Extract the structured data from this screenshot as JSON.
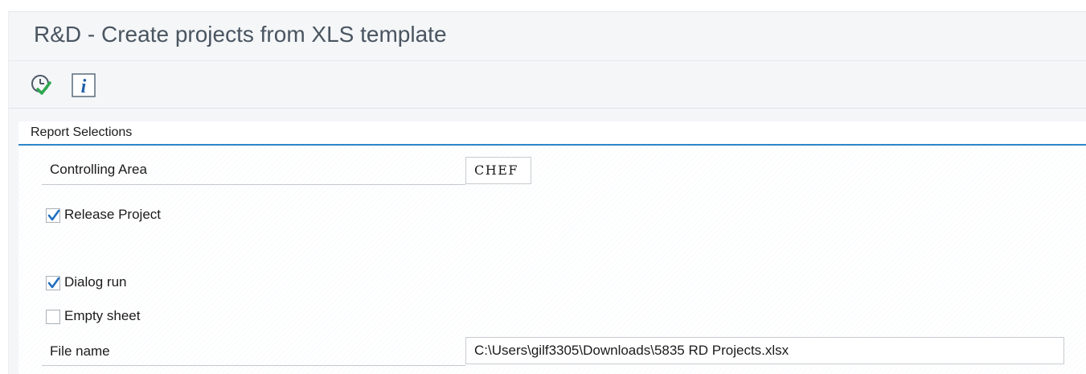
{
  "page": {
    "title": "R&D - Create projects from XLS template"
  },
  "toolbar": {
    "execute_icon": "execute-clock-check-icon",
    "info_icon": "info-icon"
  },
  "section": {
    "title": "Report Selections",
    "controlling_area": {
      "label": "Controlling Area",
      "value": "CHEF"
    },
    "release_project": {
      "label": "Release Project",
      "checked": true
    },
    "dialog_run": {
      "label": "Dialog run",
      "checked": true
    },
    "empty_sheet": {
      "label": "Empty sheet",
      "checked": false
    },
    "file_name": {
      "label": "File name",
      "value": "C:\\Users\\gilf3305\\Downloads\\5835 RD Projects.xlsx"
    }
  },
  "colors": {
    "accent_blue": "#2e86c9",
    "check_blue": "#1f6fc0",
    "execute_green": "#2fa84f"
  }
}
